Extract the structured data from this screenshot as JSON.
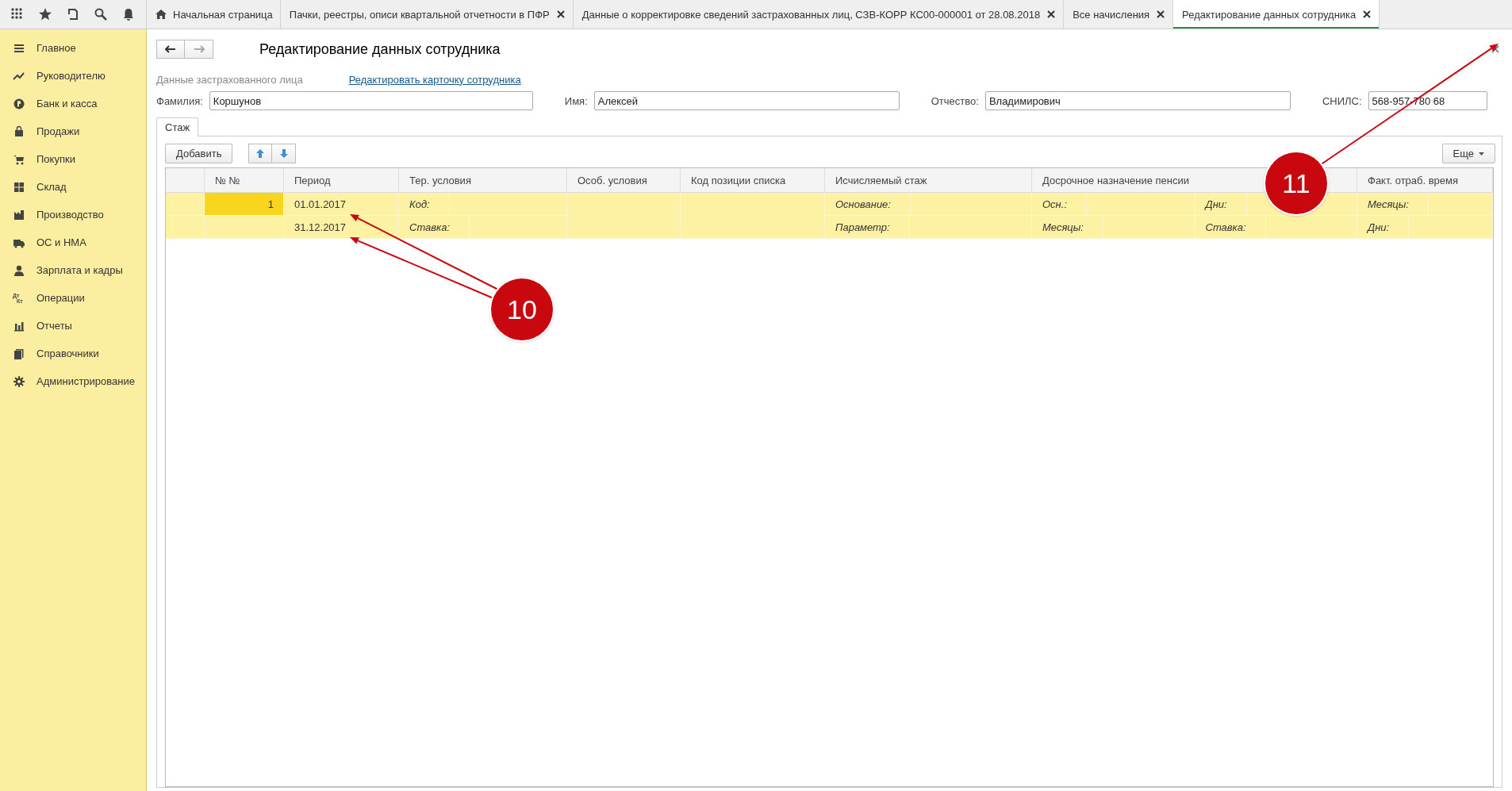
{
  "tabs": [
    {
      "label": "Начальная страница",
      "selected": false,
      "kind": "home"
    },
    {
      "label": "Пачки, реестры, описи квартальной отчетности в ПФР",
      "selected": false,
      "kind": "closable"
    },
    {
      "label": "Данные о корректировке сведений застрахованных лиц, СЗВ-КОРР КС00-000001 от 28.08.2018",
      "selected": false,
      "kind": "closable"
    },
    {
      "label": "Все начисления",
      "selected": false,
      "kind": "closable"
    },
    {
      "label": "Редактирование данных сотрудника",
      "selected": true,
      "kind": "closable"
    }
  ],
  "sidebar": {
    "items": [
      {
        "label": "Главное"
      },
      {
        "label": "Руководителю"
      },
      {
        "label": "Банк и касса"
      },
      {
        "label": "Продажи"
      },
      {
        "label": "Покупки"
      },
      {
        "label": "Склад"
      },
      {
        "label": "Производство"
      },
      {
        "label": "ОС и НМА"
      },
      {
        "label": "Зарплата и кадры"
      },
      {
        "label": "Операции",
        "icon_text": [
          "Дт",
          "Кт"
        ]
      },
      {
        "label": "Отчеты"
      },
      {
        "label": "Справочники"
      },
      {
        "label": "Администрирование"
      }
    ]
  },
  "form": {
    "title": "Редактирование данных сотрудника",
    "section_label": "Данные застрахованного лица",
    "edit_link": "Редактировать карточку сотрудника",
    "fields": [
      {
        "label": "Фамилия:",
        "value": "Коршунов"
      },
      {
        "label": "Имя:",
        "value": "Алексей"
      },
      {
        "label": "Отчество:",
        "value": "Владимирович"
      },
      {
        "label": "СНИЛС:",
        "value": "568-957-780 68"
      }
    ]
  },
  "page_tabs": [
    {
      "label": "Стаж",
      "selected": true
    }
  ],
  "table_toolbar": {
    "add": "Добавить",
    "more": "Еще"
  },
  "table": {
    "columns": [
      "№ №",
      "Период",
      "Тер. условия",
      "Особ. условия",
      "Код позиции списка",
      "Исчисляемый стаж",
      "Досрочное назначение пенсии",
      "Факт. отраб. время"
    ],
    "record": {
      "selected": true,
      "number": "1",
      "lines": [
        {
          "period": "01.01.2017",
          "territorial": "Код:",
          "calculated": "Основание:",
          "early": [
            "Осн.:",
            "Дни:"
          ],
          "actual": "Месяцы:"
        },
        {
          "period": "31.12.2017",
          "territorial": "Ставка:",
          "calculated": "Параметр:",
          "early": [
            "Месяцы:",
            "Ставка:"
          ],
          "actual": "Дни:"
        }
      ]
    }
  },
  "annotations": [
    {
      "label": "10"
    },
    {
      "label": "11"
    }
  ]
}
